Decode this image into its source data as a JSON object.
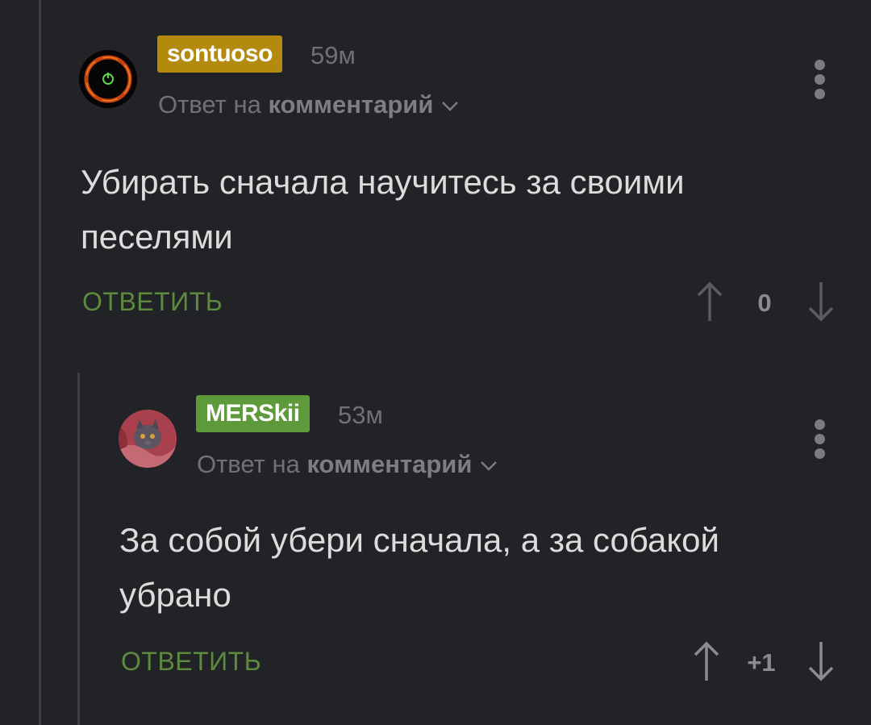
{
  "comments": [
    {
      "username": "sontuoso",
      "username_color": "#b48a0e",
      "time": "59м",
      "reply_prefix": "Ответ на",
      "reply_target": "комментарий",
      "text": "Убирать сначала научитесь за своими песелями",
      "reply_label": "ОТВЕТИТЬ",
      "score": "0",
      "avatar_icon": "power-ring-avatar-icon"
    },
    {
      "username": "MERSkii",
      "username_color": "#5e9a3c",
      "time": "53м",
      "reply_prefix": "Ответ на",
      "reply_target": "комментарий",
      "text": "За собой убери сначала, а за собакой убрано",
      "reply_label": "ОТВЕТИТЬ",
      "score": "+1",
      "avatar_icon": "cat-photo-avatar"
    }
  ],
  "colors": {
    "background": "#222326",
    "reply_green": "#5c8a3e",
    "muted": "#6f7176"
  }
}
